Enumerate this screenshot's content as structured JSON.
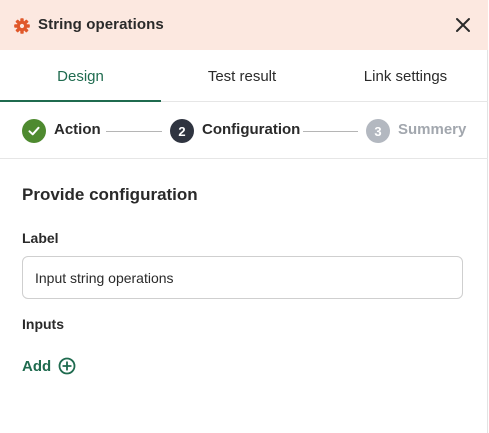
{
  "header": {
    "title": "String operations",
    "icon": "gear-icon",
    "close_icon": "close-icon",
    "background": "#fce8e0",
    "icon_color": "#e0582a"
  },
  "tabs": [
    {
      "label": "Design",
      "active": true
    },
    {
      "label": "Test result",
      "active": false
    },
    {
      "label": "Link settings",
      "active": false
    }
  ],
  "stepper": {
    "steps": [
      {
        "number": "1",
        "label": "Action",
        "state": "completed",
        "icon": "check-icon",
        "color": "#4e8a2f"
      },
      {
        "number": "2",
        "label": "Configuration",
        "state": "current",
        "color": "#2f3440"
      },
      {
        "number": "3",
        "label": "Summery",
        "state": "pending",
        "color": "#b3b8c0"
      }
    ]
  },
  "form": {
    "section_title": "Provide configuration",
    "label_field": {
      "label": "Label",
      "value": "Input string operations"
    },
    "inputs": {
      "label": "Inputs",
      "add_label": "Add",
      "add_icon": "plus-circle-icon"
    }
  },
  "colors": {
    "accent": "#1f6b4f"
  }
}
